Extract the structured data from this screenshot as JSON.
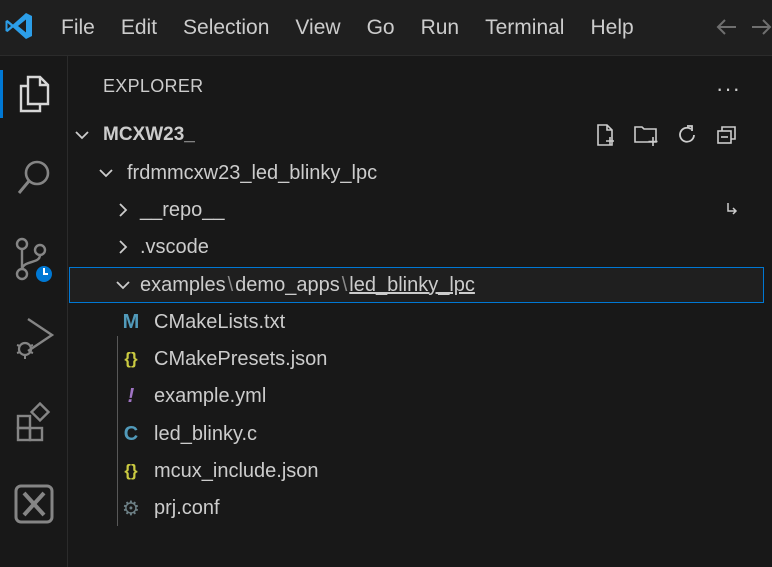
{
  "menu": {
    "items": [
      "File",
      "Edit",
      "Selection",
      "View",
      "Go",
      "Run",
      "Terminal",
      "Help"
    ]
  },
  "activity_bar": {
    "icons": [
      "explorer-icon",
      "search-icon",
      "source-control-icon",
      "run-debug-icon",
      "extensions-icon",
      "mcuxpresso-icon"
    ],
    "active": "explorer-icon",
    "accent": "#0078d4"
  },
  "explorer": {
    "title": "EXPLORER",
    "more": "···",
    "workspace": "MCXW23_",
    "project": "frdmmcxw23_led_blinky_lpc",
    "folders": [
      {
        "label": "__repo__",
        "expanded": false
      },
      {
        "label": ".vscode",
        "expanded": false
      }
    ],
    "compact_path": {
      "part1": "examples",
      "sep": "\\",
      "part2": "demo_apps",
      "part3": "led_blinky_lpc"
    },
    "files": [
      {
        "icon": "M",
        "icon_name": "cmake-icon",
        "color": "#519aba",
        "label": "CMakeLists.txt"
      },
      {
        "icon": "{}",
        "icon_name": "json-icon",
        "color": "#cbcb41",
        "label": "CMakePresets.json"
      },
      {
        "icon": "!",
        "icon_name": "yaml-icon",
        "color": "#a074c4",
        "label": "example.yml"
      },
      {
        "icon": "C",
        "icon_name": "c-file-icon",
        "color": "#519aba",
        "label": "led_blinky.c"
      },
      {
        "icon": "{}",
        "icon_name": "json-icon",
        "color": "#cbcb41",
        "label": "mcux_include.json"
      },
      {
        "icon": "⚙",
        "icon_name": "config-gear-icon",
        "color": "#6d8086",
        "label": "prj.conf"
      }
    ]
  }
}
